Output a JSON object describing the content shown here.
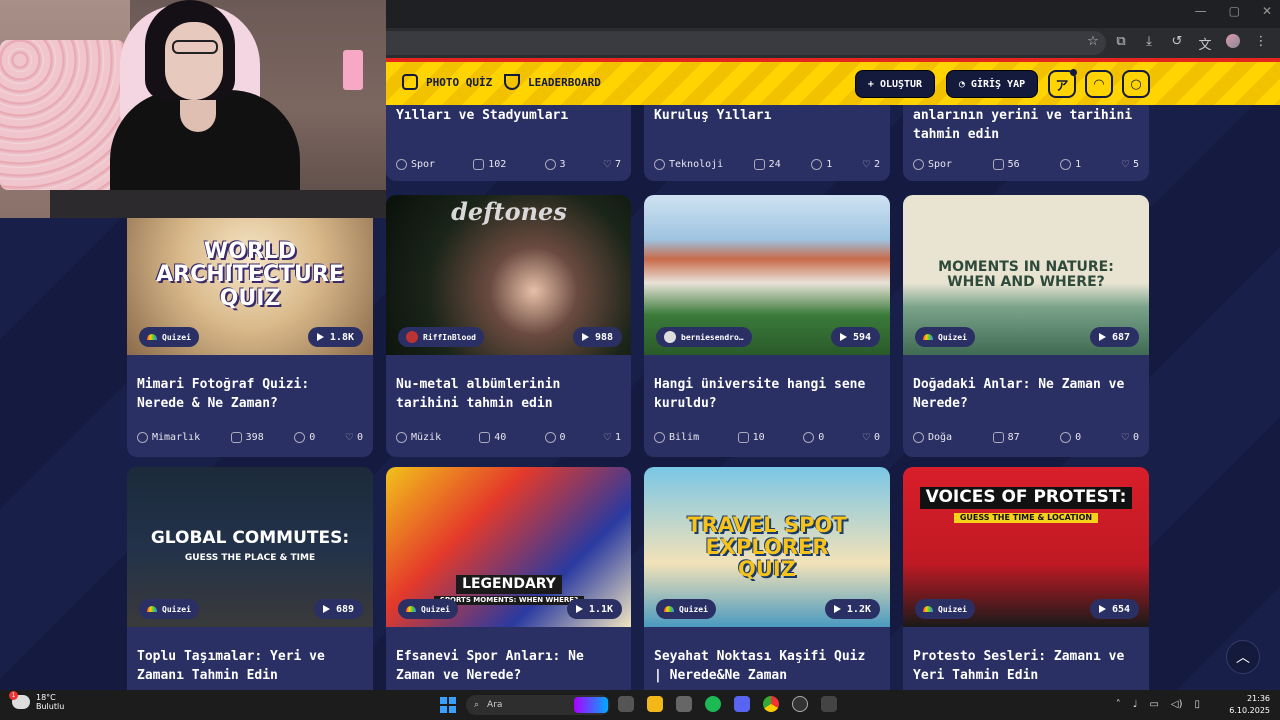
{
  "nav": {
    "photo_quiz": "PHOTO QUİZ",
    "leaderboard": "LEADERBOARD",
    "create": "OLUŞTUR",
    "login": "GİRİŞ YAP"
  },
  "top_row": [
    {
      "title": "Yılları ve Stadyumları",
      "category": "Spor",
      "photos": "102",
      "comments": "3",
      "likes": "7"
    },
    {
      "title": "Kuruluş Yılları",
      "category": "Teknoloji",
      "photos": "24",
      "comments": "1",
      "likes": "2"
    },
    {
      "title": "anlarının yerini ve tarihini tahmin edin",
      "category": "Spor",
      "photos": "56",
      "comments": "1",
      "likes": "5"
    }
  ],
  "row1": [
    {
      "art": "WORLD ARCHITECTURE QUIZ",
      "author": "Quizei",
      "plays": "1.8K",
      "title": "Mimari Fotoğraf Quizi: Nerede & Ne Zaman?",
      "category": "Mimarlık",
      "photos": "398",
      "comments": "0",
      "likes": "0"
    },
    {
      "art": "deftones",
      "author": "RiffInBlood",
      "plays": "988",
      "title": "Nu-metal albümlerinin tarihini tahmin edin",
      "category": "Müzik",
      "photos": "40",
      "comments": "0",
      "likes": "1"
    },
    {
      "art": "",
      "author": "berniesendro…",
      "plays": "594",
      "title": "Hangi üniversite hangi sene kuruldu?",
      "category": "Bilim",
      "photos": "10",
      "comments": "0",
      "likes": "0"
    },
    {
      "art": "MOMENTS IN NATURE: WHEN AND WHERE?",
      "author": "Quizei",
      "plays": "687",
      "title": "Doğadaki Anlar: Ne Zaman ve Nerede?",
      "category": "Doğa",
      "photos": "87",
      "comments": "0",
      "likes": "0"
    }
  ],
  "row2": [
    {
      "art": "GLOBAL COMMUTES:",
      "art_sub": "GUESS THE PLACE & TIME",
      "author": "Quizei",
      "plays": "689",
      "title": "Toplu Taşımalar: Yeri ve Zamanı Tahmin Edin"
    },
    {
      "art": "LEGENDARY",
      "art_sub": "SPORTS MOMENTS: WHEN WHERE?",
      "author": "Quizei",
      "plays": "1.1K",
      "title": "Efsanevi Spor Anları: Ne Zaman ve Nerede?"
    },
    {
      "art": "TRAVEL SPOT EXPLORER QUIZ",
      "art_sub": "",
      "author": "Quizei",
      "plays": "1.2K",
      "title": "Seyahat Noktası Kaşifi Quiz | Nerede&Ne Zaman"
    },
    {
      "art": "VOICES OF PROTEST:",
      "art_sub": "GUESS THE TIME & LOCATION",
      "author": "Quizei",
      "plays": "654",
      "title": "Protesto Sesleri: Zamanı ve Yeri Tahmin Edin"
    }
  ],
  "taskbar": {
    "temp": "18°C",
    "weather": "Bulutlu",
    "search": "Ara",
    "time": "21:36",
    "date": "6.10.2025"
  }
}
